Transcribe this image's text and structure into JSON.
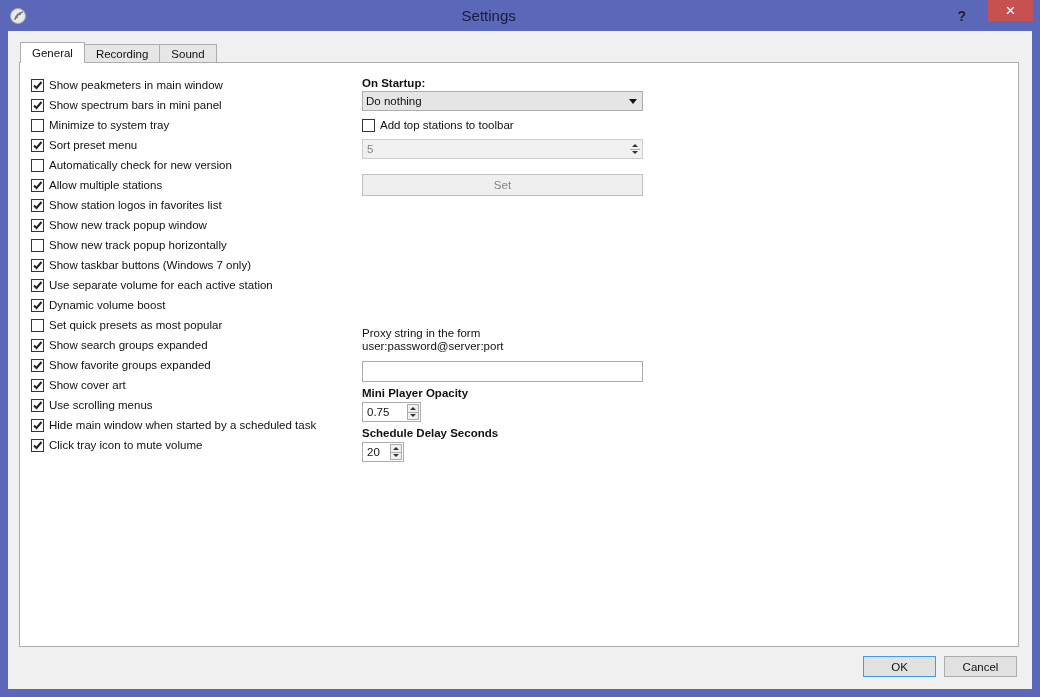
{
  "window": {
    "title": "Settings",
    "help": "?",
    "close": "×"
  },
  "tabs": [
    {
      "label": "General",
      "selected": true
    },
    {
      "label": "Recording",
      "selected": false
    },
    {
      "label": "Sound",
      "selected": false
    }
  ],
  "options": [
    {
      "label": "Show peakmeters in main window",
      "checked": true
    },
    {
      "label": "Show spectrum bars in mini panel",
      "checked": true
    },
    {
      "label": "Minimize to system tray",
      "checked": false
    },
    {
      "label": "Sort preset menu",
      "checked": true
    },
    {
      "label": "Automatically check for new version",
      "checked": false
    },
    {
      "label": "Allow multiple stations",
      "checked": true
    },
    {
      "label": "Show station logos in favorites list",
      "checked": true
    },
    {
      "label": "Show new track popup window",
      "checked": true
    },
    {
      "label": "Show new track popup horizontally",
      "checked": false
    },
    {
      "label": "Show taskbar buttons (Windows 7 only)",
      "checked": true
    },
    {
      "label": "Use separate volume for each active station",
      "checked": true
    },
    {
      "label": "Dynamic volume boost",
      "checked": true
    },
    {
      "label": "Set quick presets as most popular",
      "checked": false
    },
    {
      "label": "Show search groups expanded",
      "checked": true
    },
    {
      "label": "Show favorite groups expanded",
      "checked": true
    },
    {
      "label": "Show cover art",
      "checked": true
    },
    {
      "label": "Use scrolling menus",
      "checked": true
    },
    {
      "label": "Hide main window when started by a scheduled task",
      "checked": true
    },
    {
      "label": "Click tray icon to mute volume",
      "checked": true
    }
  ],
  "startup": {
    "label": "On Startup:",
    "value": "Do nothing"
  },
  "top_stations": {
    "label": "Add top stations to toolbar",
    "checked": false,
    "count": "5",
    "disabled": true
  },
  "set_button": {
    "label": "Set",
    "disabled": true
  },
  "proxy": {
    "label": "Proxy string in the form\nuser:password@server:port"
  },
  "opacity": {
    "label": "Mini Player Opacity",
    "value": "0.75"
  },
  "delay": {
    "label": "Schedule Delay Seconds",
    "value": "20"
  },
  "buttons": [
    {
      "label": "OK",
      "kind": "default"
    },
    {
      "label": "Cancel",
      "kind": "normal"
    }
  ]
}
